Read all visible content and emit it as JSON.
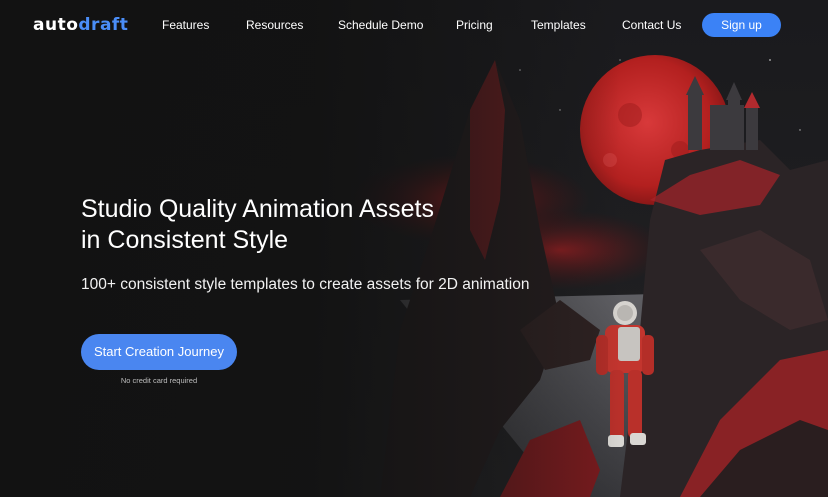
{
  "brand": {
    "logo_part1": "auto",
    "logo_part2": "draft",
    "accent": "#3b82f6"
  },
  "nav": {
    "links": [
      {
        "label": "Features"
      },
      {
        "label": "Resources"
      },
      {
        "label": "Schedule Demo"
      },
      {
        "label": "Pricing"
      },
      {
        "label": "Templates"
      },
      {
        "label": "Contact Us"
      }
    ],
    "signup_label": "Sign up"
  },
  "hero": {
    "headline_line1": "Studio Quality Animation Assets",
    "headline_line2": "in Consistent Style",
    "subheadline": "100+ consistent style templates to create assets for 2D animation",
    "cta_label": "Start Creation Journey",
    "cta_note": "No credit card required",
    "image": {
      "description_icon": "astronaut-castle-artwork",
      "palette": {
        "moon": "#c0282a",
        "rock": "#3a2a2a",
        "accent_red": "#d11f24"
      }
    }
  }
}
